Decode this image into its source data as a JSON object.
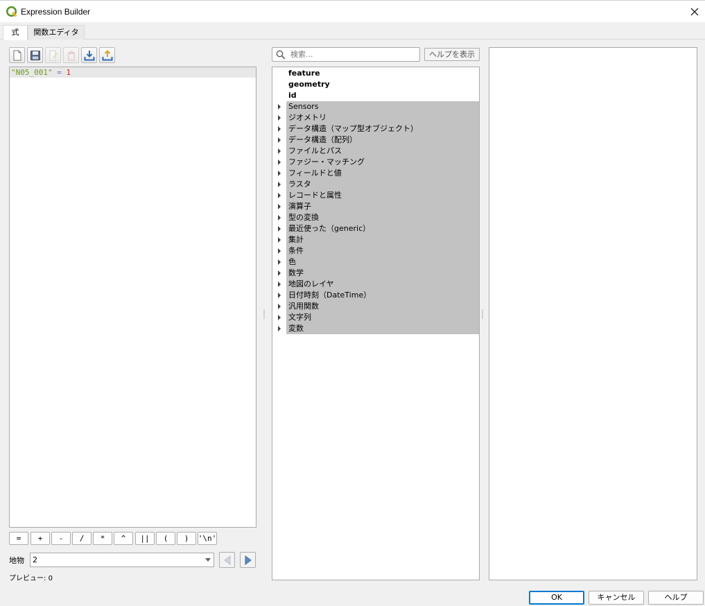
{
  "window": {
    "title": "Expression Builder"
  },
  "tabs": [
    {
      "label": "式"
    },
    {
      "label": "関数エディタ"
    }
  ],
  "toolbar": {
    "icons": [
      "new-file-icon",
      "save-icon",
      "edit-icon",
      "delete-icon",
      "import-icon",
      "export-icon"
    ]
  },
  "editor": {
    "expression_field": "\"N05_001\"",
    "expression_op": "=",
    "expression_value": "1"
  },
  "operators": [
    "=",
    "+",
    "-",
    "/",
    "*",
    "^",
    "||",
    "(",
    ")",
    "'\\n'"
  ],
  "feature": {
    "label": "地物",
    "value": "2"
  },
  "preview": {
    "label": "プレビュー:",
    "value": "0"
  },
  "search": {
    "placeholder": "検索..."
  },
  "help_button": "ヘルプを表示",
  "tree": {
    "fixed": [
      "feature",
      "geometry",
      "id"
    ],
    "groups": [
      "Sensors",
      "ジオメトリ",
      "データ構造（マップ型オブジェクト）",
      "データ構造（配列）",
      "ファイルとパス",
      "ファジー・マッチング",
      "フィールドと値",
      "ラスタ",
      "レコードと属性",
      "演算子",
      "型の変換",
      "最近使った（generic）",
      "集計",
      "条件",
      "色",
      "数学",
      "地図のレイヤ",
      "日付時刻（DateTime）",
      "汎用関数",
      "文字列",
      "変数"
    ]
  },
  "buttons": {
    "ok": "OK",
    "cancel": "キャンセル",
    "help": "ヘルプ"
  },
  "colors": {
    "group_bg": "#c2c2c2",
    "string_token": "#6a9b1c",
    "number_token": "#d02020",
    "accent": "#0078d4"
  }
}
